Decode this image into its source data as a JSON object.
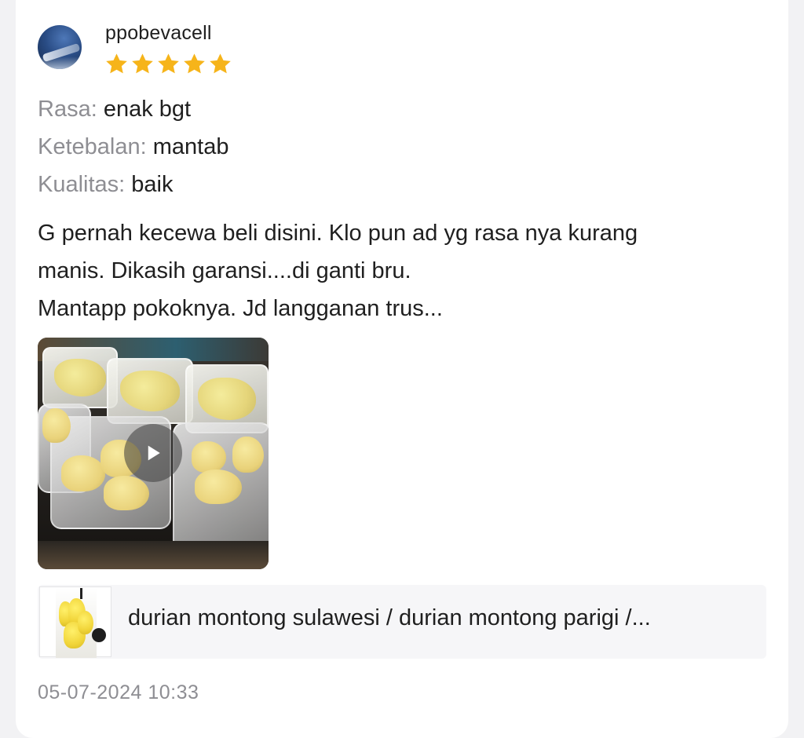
{
  "review": {
    "username": "ppobevacell",
    "rating": 5,
    "rating_max": 5,
    "star_color": "#F6B41A",
    "attributes": [
      {
        "label": "Rasa:",
        "value": "enak bgt"
      },
      {
        "label": "Ketebalan:",
        "value": "mantab"
      },
      {
        "label": "Kualitas:",
        "value": "baik"
      }
    ],
    "text_lines": [
      "G pernah kecewa beli disini. Klo pun ad yg rasa nya kurang",
      "manis. Dikasih garansi....di ganti bru.",
      "Mantapp pokoknya. Jd langganan trus..."
    ],
    "media": {
      "type": "video",
      "play_icon": "play-icon"
    },
    "product": {
      "name": "durian montong sulawesi / durian montong parigi /..."
    },
    "timestamp": "05-07-2024 10:33"
  }
}
